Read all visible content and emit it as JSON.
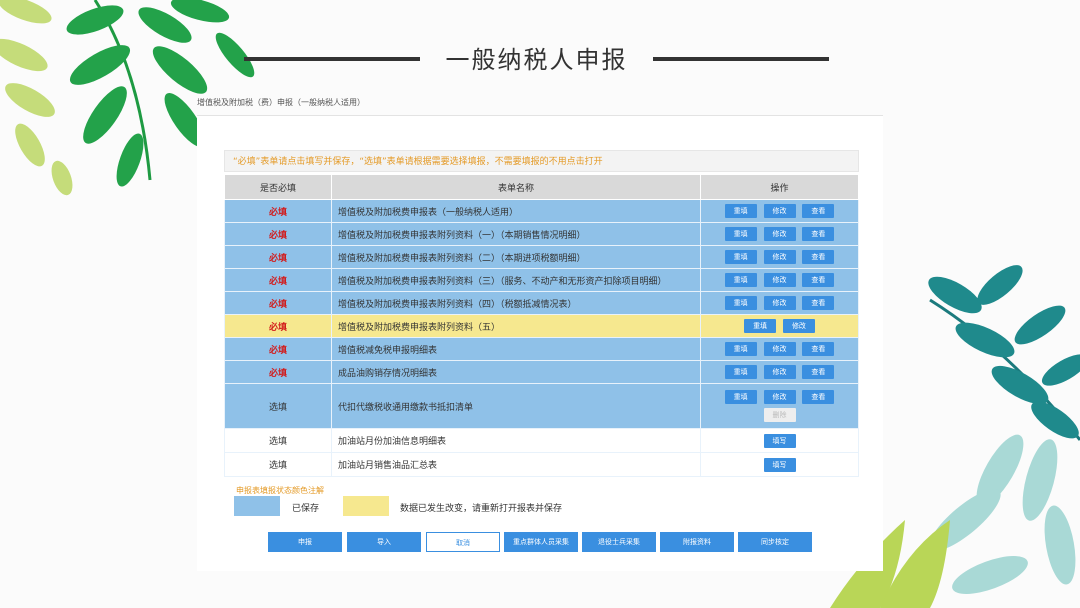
{
  "header": {
    "title": "一般纳税人申报"
  },
  "breadcrumb": "增值税及附加税（费）申报（一般纳税人适用）",
  "notice": "“必填”表单请点击填写并保存，“选填”表单请根据需要选择填报，不需要填报的不用点击打开",
  "table": {
    "headers": [
      "是否必填",
      "表单名称",
      "操作"
    ],
    "rows": [
      {
        "required": "必填",
        "name": "增值税及附加税费申报表（一般纳税人适用）",
        "actions": [
          "重填",
          "修改",
          "查看"
        ]
      },
      {
        "required": "必填",
        "name": "增值税及附加税费申报表附列资料（一）（本期销售情况明细）",
        "actions": [
          "重填",
          "修改",
          "查看"
        ]
      },
      {
        "required": "必填",
        "name": "增值税及附加税费申报表附列资料（二）（本期进项税额明细）",
        "actions": [
          "重填",
          "修改",
          "查看"
        ]
      },
      {
        "required": "必填",
        "name": "增值税及附加税费申报表附列资料（三）（服务、不动产和无形资产扣除项目明细）",
        "actions": [
          "重填",
          "修改",
          "查看"
        ]
      },
      {
        "required": "必填",
        "name": "增值税及附加税费申报表附列资料（四）（税额抵减情况表）",
        "actions": [
          "重填",
          "修改",
          "查看"
        ]
      },
      {
        "required": "必填",
        "name": "增值税及附加税费申报表附列资料（五）",
        "actions": [
          "重填",
          "修改"
        ]
      },
      {
        "required": "必填",
        "name": "增值税减免税申报明细表",
        "actions": [
          "重填",
          "修改",
          "查看"
        ]
      },
      {
        "required": "必填",
        "name": "成品油购销存情况明细表",
        "actions": [
          "重填",
          "修改",
          "查看"
        ]
      },
      {
        "required": "选填",
        "name": "代扣代缴税收通用缴款书抵扣清单",
        "actions": [
          "重填",
          "修改",
          "查看"
        ],
        "extra": "删除"
      },
      {
        "required": "选填",
        "name": "加油站月份加油信息明细表",
        "actions": [
          "填写"
        ]
      },
      {
        "required": "选填",
        "name": "加油站月销售油品汇总表",
        "actions": [
          "填写"
        ]
      }
    ]
  },
  "legend": {
    "title": "申报表填报状态颜色注解",
    "saved": "已保存",
    "changed": "数据已发生改变，请重新打开报表并保存"
  },
  "bottom_buttons": [
    "申报",
    "导入",
    "取消",
    "重点群体人员采集",
    "退役士兵采集",
    "附报资料",
    "同步核定"
  ],
  "colors": {
    "saved": "#8fc1e8",
    "changed": "#f6e88f",
    "button": "#3a8fe0",
    "required": "#d21b1b",
    "notice": "#e49a26"
  }
}
